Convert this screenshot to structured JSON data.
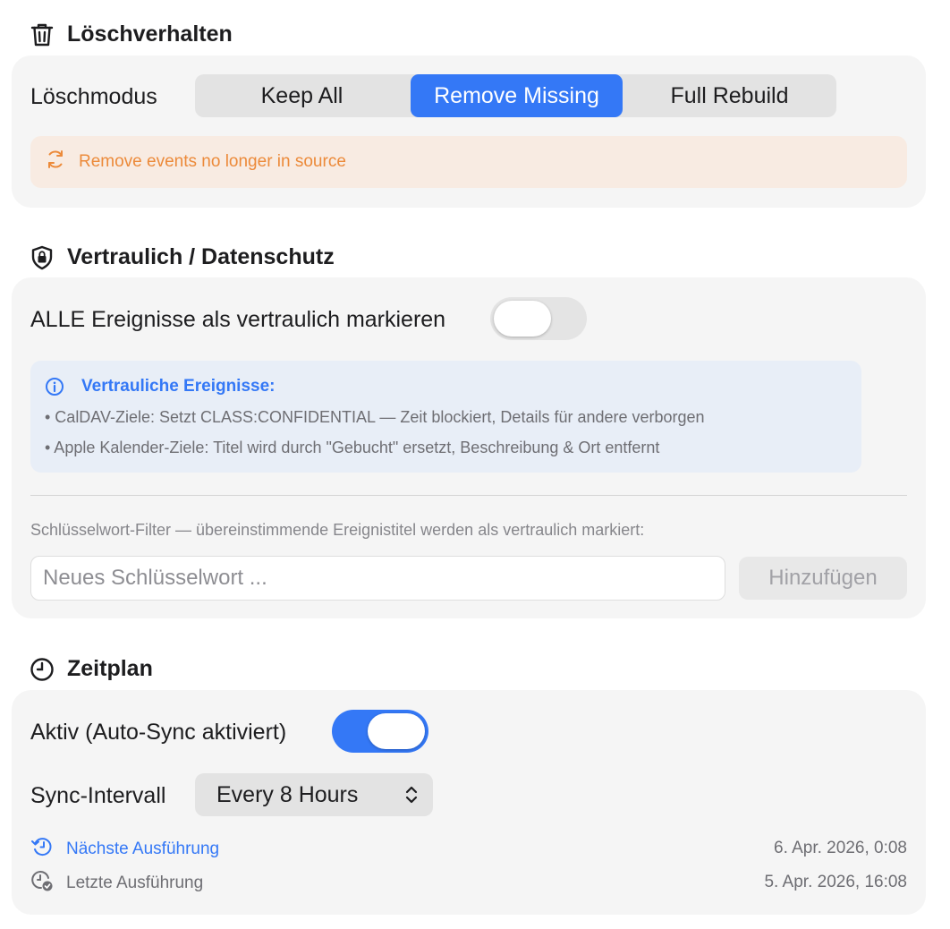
{
  "delete": {
    "title": "Löschverhalten",
    "mode_label": "Löschmodus",
    "options": [
      "Keep All",
      "Remove Missing",
      "Full Rebuild"
    ],
    "selected_index": 1,
    "info_text": "Remove events no longer in source",
    "warn_color": "#ec8a3a"
  },
  "privacy": {
    "title": "Vertraulich / Datenschutz",
    "toggle_label": "ALLE Ereignisse als vertraulich markieren",
    "toggle_on": false,
    "info_title": "Vertrauliche Ereignisse:",
    "info_lines": [
      "• CalDAV-Ziele: Setzt CLASS:CONFIDENTIAL — Zeit blockiert, Details für andere verborgen",
      "• Apple Kalender-Ziele: Titel wird durch \"Gebucht\" ersetzt, Beschreibung & Ort entfernt"
    ],
    "keyword_label": "Schlüsselwort-Filter — übereinstimmende Ereignistitel werden als vertraulich markiert:",
    "keyword_placeholder": "Neues Schlüsselwort ...",
    "keyword_value": "",
    "add_button": "Hinzufügen"
  },
  "schedule": {
    "title": "Zeitplan",
    "active_label": "Aktiv (Auto-Sync aktiviert)",
    "active_on": true,
    "interval_label": "Sync-Intervall",
    "interval_value": "Every 8 Hours",
    "next_label": "Nächste Ausführung",
    "next_value": "6. Apr. 2026, 0:08",
    "last_label": "Letzte Ausführung",
    "last_value": "5. Apr. 2026, 16:08"
  },
  "colors": {
    "accent": "#3478f6",
    "warning": "#ec8a3a",
    "card_bg": "#f5f5f5"
  }
}
